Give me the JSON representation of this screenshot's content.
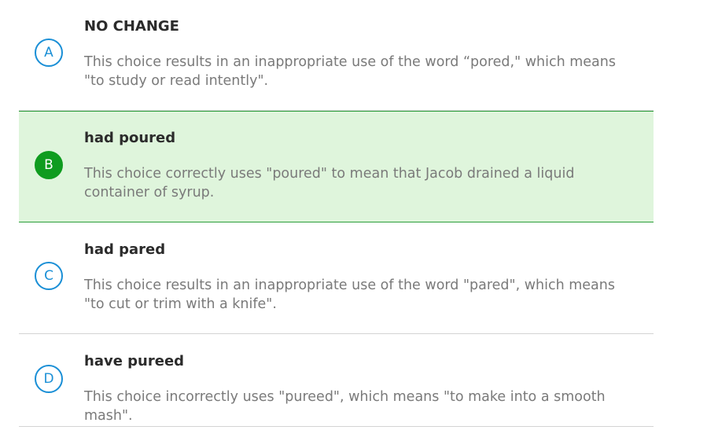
{
  "choices": [
    {
      "letter": "A",
      "answer": "NO CHANGE",
      "explanation": "This choice results in an inappropriate use of the word “pored,\" which means \"to study or read intently\".",
      "selected": false
    },
    {
      "letter": "B",
      "answer": "had poured",
      "explanation": "This choice correctly uses \"poured\" to mean that Jacob drained a liquid container of syrup.",
      "selected": true
    },
    {
      "letter": "C",
      "answer": "had pared",
      "explanation": "This choice results in an inappropriate use of the word \"pared\", which means \"to cut or trim with a knife\".",
      "selected": false
    },
    {
      "letter": "D",
      "answer": "have pureed",
      "explanation": "This choice incorrectly uses \"pureed\", which means \"to make into a smooth mash\".",
      "selected": false
    }
  ],
  "colors": {
    "accent_blue": "#1a8fd6",
    "correct_green": "#0f9c1f",
    "selected_bg": "#dff5dc"
  }
}
